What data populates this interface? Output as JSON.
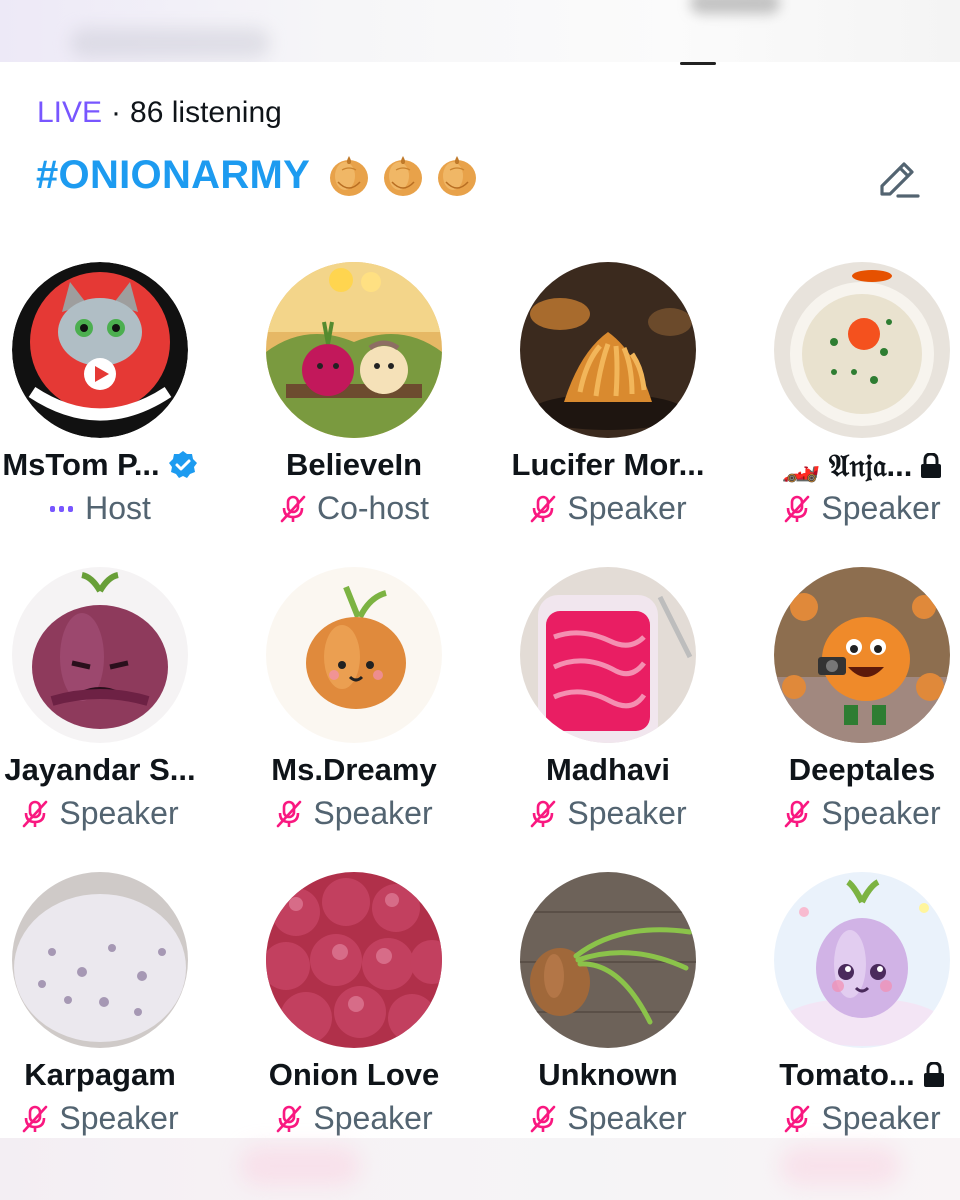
{
  "space": {
    "live_label": "LIVE",
    "separator": "·",
    "listening": "86 listening",
    "title": "#ONIONARMY",
    "title_emoji": [
      "onion",
      "onion",
      "onion"
    ],
    "edit_icon": "edit-pencil-icon"
  },
  "colors": {
    "live": "#7856ff",
    "title": "#1d9bf0",
    "role_text": "#536471",
    "muted_mic": "#f91880",
    "verified": "#1d9bf0"
  },
  "participants": [
    {
      "name": "MsTom P...",
      "role": "Host",
      "role_icon": "host-dots-icon",
      "badge": "verified-icon",
      "avatar": "cat-logo-avatar"
    },
    {
      "name": "BelieveIn",
      "role": "Co-host",
      "role_icon": "mic-muted-icon",
      "badge": "",
      "avatar": "onion-couple-avatar"
    },
    {
      "name": "Lucifer Mor...",
      "role": "Speaker",
      "role_icon": "mic-muted-icon",
      "badge": "",
      "avatar": "blooming-onion-avatar"
    },
    {
      "name": "🏎️ 𝔄𝔫𝔧𝔞...",
      "role": "Speaker",
      "role_icon": "mic-muted-icon",
      "badge": "lock-icon",
      "avatar": "dosa-plate-avatar"
    },
    {
      "name": "Jayandar S...",
      "role": "Speaker",
      "role_icon": "mic-muted-icon",
      "badge": "",
      "avatar": "grumpy-onion-avatar"
    },
    {
      "name": "Ms.Dreamy",
      "role": "Speaker",
      "role_icon": "mic-muted-icon",
      "badge": "",
      "avatar": "cute-onion-avatar"
    },
    {
      "name": "Madhavi",
      "role": "Speaker",
      "role_icon": "mic-muted-icon",
      "badge": "",
      "avatar": "pickled-onion-jar-avatar"
    },
    {
      "name": "Deeptales",
      "role": "Speaker",
      "role_icon": "mic-muted-icon",
      "badge": "",
      "avatar": "onion-photographer-avatar"
    },
    {
      "name": "Karpagam",
      "role": "Speaker",
      "role_icon": "mic-muted-icon",
      "badge": "",
      "avatar": "onion-raita-avatar"
    },
    {
      "name": "Onion Love",
      "role": "Speaker",
      "role_icon": "mic-muted-icon",
      "badge": "",
      "avatar": "red-onions-pile-avatar"
    },
    {
      "name": "Unknown",
      "role": "Speaker",
      "role_icon": "mic-muted-icon",
      "badge": "",
      "avatar": "sprouting-onion-avatar"
    },
    {
      "name": "Tomato...",
      "role": "Speaker",
      "role_icon": "mic-muted-icon",
      "badge": "lock-icon",
      "avatar": "kawaii-onion-avatar"
    }
  ]
}
